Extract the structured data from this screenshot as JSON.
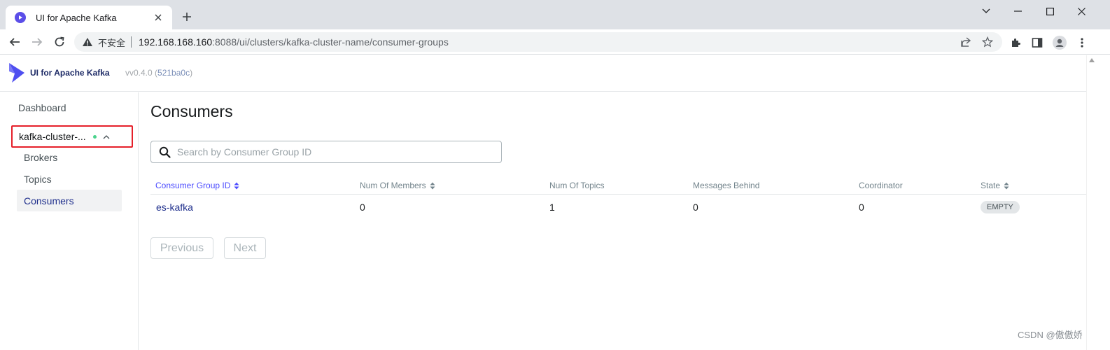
{
  "browser": {
    "tab_title": "UI for Apache Kafka",
    "insecure_label": "不安全",
    "url_host": "192.168.168.160",
    "url_rest": ":8088/ui/clusters/kafka-cluster-name/consumer-groups"
  },
  "app": {
    "title": "UI for Apache Kafka",
    "version_prefix": "vv0.4.0 (",
    "version_hash": "521ba0c",
    "version_suffix": ")"
  },
  "sidebar": {
    "dashboard": "Dashboard",
    "cluster_name": "kafka-cluster-...",
    "cluster_status_color": "#4bd38d",
    "items": [
      {
        "label": "Brokers"
      },
      {
        "label": "Topics"
      },
      {
        "label": "Consumers"
      }
    ]
  },
  "main": {
    "title": "Consumers",
    "search_placeholder": "Search by Consumer Group ID",
    "columns": [
      {
        "label": "Consumer Group ID"
      },
      {
        "label": "Num Of Members"
      },
      {
        "label": "Num Of Topics"
      },
      {
        "label": "Messages Behind"
      },
      {
        "label": "Coordinator"
      },
      {
        "label": "State"
      }
    ],
    "rows": [
      {
        "group_id": "es-kafka",
        "members": "0",
        "topics": "1",
        "behind": "0",
        "coordinator": "0",
        "state": "EMPTY"
      }
    ],
    "previous_label": "Previous",
    "next_label": "Next"
  },
  "watermark": "CSDN @傲傲娇",
  "colors": {
    "accent": "#4c4cff",
    "link": "#1f2f8c",
    "highlight_border": "#e5202a",
    "favicon": "#5b4ee8"
  }
}
